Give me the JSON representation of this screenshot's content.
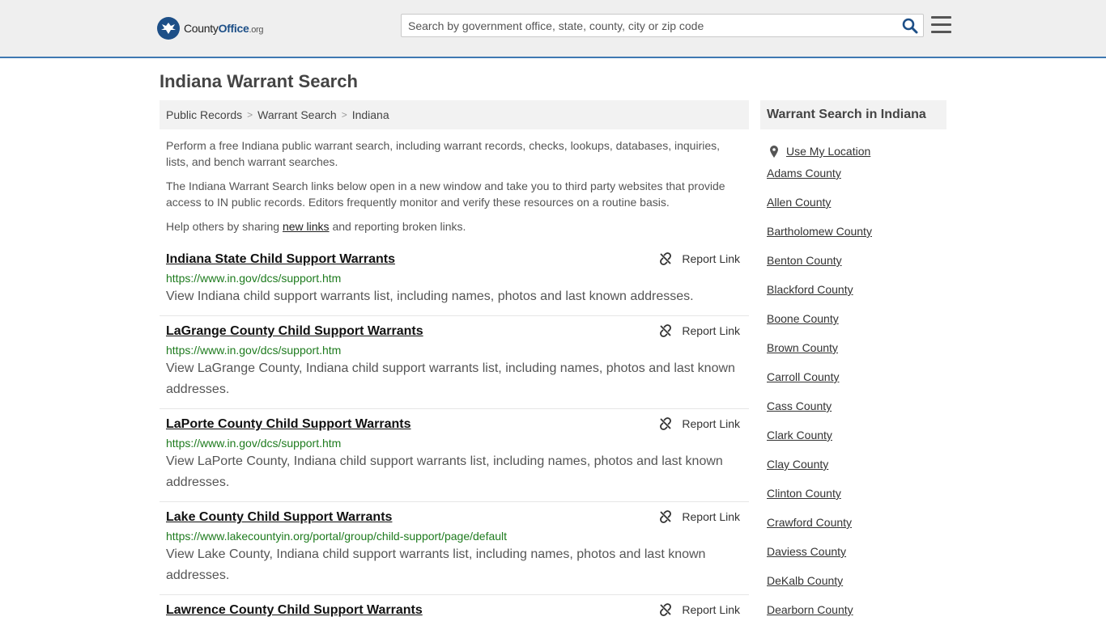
{
  "header": {
    "logo_main": "County",
    "logo_bold": "Office",
    "logo_suffix": ".org",
    "search_placeholder": "Search by government office, state, county, city or zip code"
  },
  "page": {
    "title": "Indiana Warrant Search"
  },
  "breadcrumb": [
    "Public Records",
    "Warrant Search",
    "Indiana"
  ],
  "intro": {
    "p1": "Perform a free Indiana public warrant search, including warrant records, checks, lookups, databases, inquiries, lists, and bench warrant searches.",
    "p2": "The Indiana Warrant Search links below open in a new window and take you to third party websites that provide access to IN public records. Editors frequently monitor and verify these resources on a routine basis.",
    "p3_before": "Help others by sharing ",
    "p3_link": "new links",
    "p3_after": " and reporting broken links."
  },
  "report_label": "Report Link",
  "records": [
    {
      "title": "Indiana State Child Support Warrants",
      "url": "https://www.in.gov/dcs/support.htm",
      "desc": "View Indiana child support warrants list, including names, photos and last known addresses."
    },
    {
      "title": "LaGrange County Child Support Warrants",
      "url": "https://www.in.gov/dcs/support.htm",
      "desc": "View LaGrange County, Indiana child support warrants list, including names, photos and last known addresses."
    },
    {
      "title": "LaPorte County Child Support Warrants",
      "url": "https://www.in.gov/dcs/support.htm",
      "desc": "View LaPorte County, Indiana child support warrants list, including names, photos and last known addresses."
    },
    {
      "title": "Lake County Child Support Warrants",
      "url": "https://www.lakecountyin.org/portal/group/child-support/page/default",
      "desc": "View Lake County, Indiana child support warrants list, including names, photos and last known addresses."
    },
    {
      "title": "Lawrence County Child Support Warrants",
      "url": "",
      "desc": ""
    }
  ],
  "sidebar": {
    "title": "Warrant Search in Indiana",
    "use_location": "Use My Location",
    "counties": [
      "Adams County",
      "Allen County",
      "Bartholomew County",
      "Benton County",
      "Blackford County",
      "Boone County",
      "Brown County",
      "Carroll County",
      "Cass County",
      "Clark County",
      "Clay County",
      "Clinton County",
      "Crawford County",
      "Daviess County",
      "DeKalb County",
      "Dearborn County"
    ]
  },
  "colors": {
    "header_bg": "#efefef",
    "brand_blue": "#1d4f87",
    "accent_line": "#3e78b2",
    "url_green": "#1e7b1e"
  }
}
